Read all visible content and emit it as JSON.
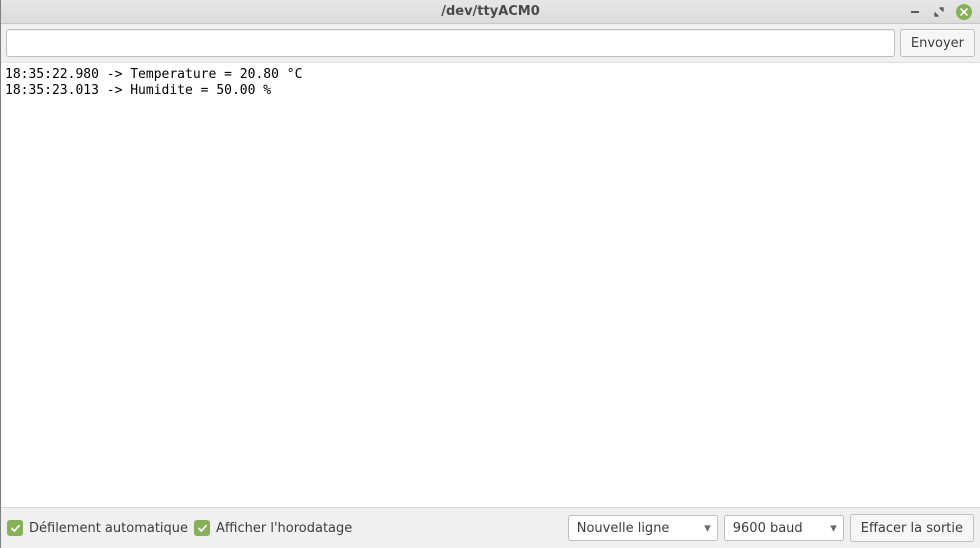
{
  "window": {
    "title": "/dev/ttyACM0"
  },
  "toolbar": {
    "input_value": "",
    "input_placeholder": "",
    "send_label": "Envoyer"
  },
  "output": {
    "lines": [
      "18:35:22.980 -> Temperature = 20.80 °C",
      "18:35:23.013 -> Humidite = 50.00 %"
    ]
  },
  "statusbar": {
    "autoscroll_label": "Défilement automatique",
    "autoscroll_checked": true,
    "showtimestamp_label": "Afficher l'horodatage",
    "showtimestamp_checked": true,
    "line_ending_selected": "Nouvelle ligne",
    "baud_selected": "9600 baud",
    "clear_label": "Effacer la sortie"
  },
  "icons": {
    "check": "✓",
    "chevron_down": "▾"
  }
}
